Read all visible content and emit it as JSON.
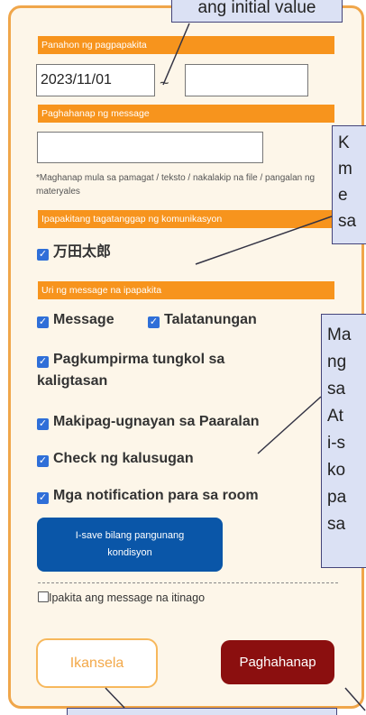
{
  "form": {
    "period_label": "Panahon ng pagpapakita",
    "date_from": "2023/11/01",
    "date_to": "",
    "range_sep": "~",
    "search_label": "Paghahanap ng message",
    "search_value": "",
    "search_note": "*Maghanap mula sa pamagat / teksto / nakalakip na file / pangalan ng materyales",
    "recipient_label": "Ipapakitang tagatanggap ng komunikasyon",
    "recipient_name": "万田太郎",
    "type_label": "Uri ng message na ipapakita",
    "types": {
      "message": "Message",
      "survey": "Talatanungan",
      "safety": "Pagkumpirma tungkol sa kaligtasan",
      "school": "Makipag-ugnayan sa Paaralan",
      "health": "Check ng kalusugan",
      "room": "Mga notification para sa room"
    },
    "save_condition_line1": "I-save bilang pangunang",
    "save_condition_line2": "kondisyon",
    "show_hidden": "Ipakita ang message na itinago",
    "cancel": "Ikansela",
    "search": "Paghahanap"
  },
  "callouts": {
    "top": "ang initial value",
    "keyword": "K\nm\ne\nsa",
    "type": "Ma\nng\nsa\nAt\ni-s\nko\npa\nsa"
  }
}
